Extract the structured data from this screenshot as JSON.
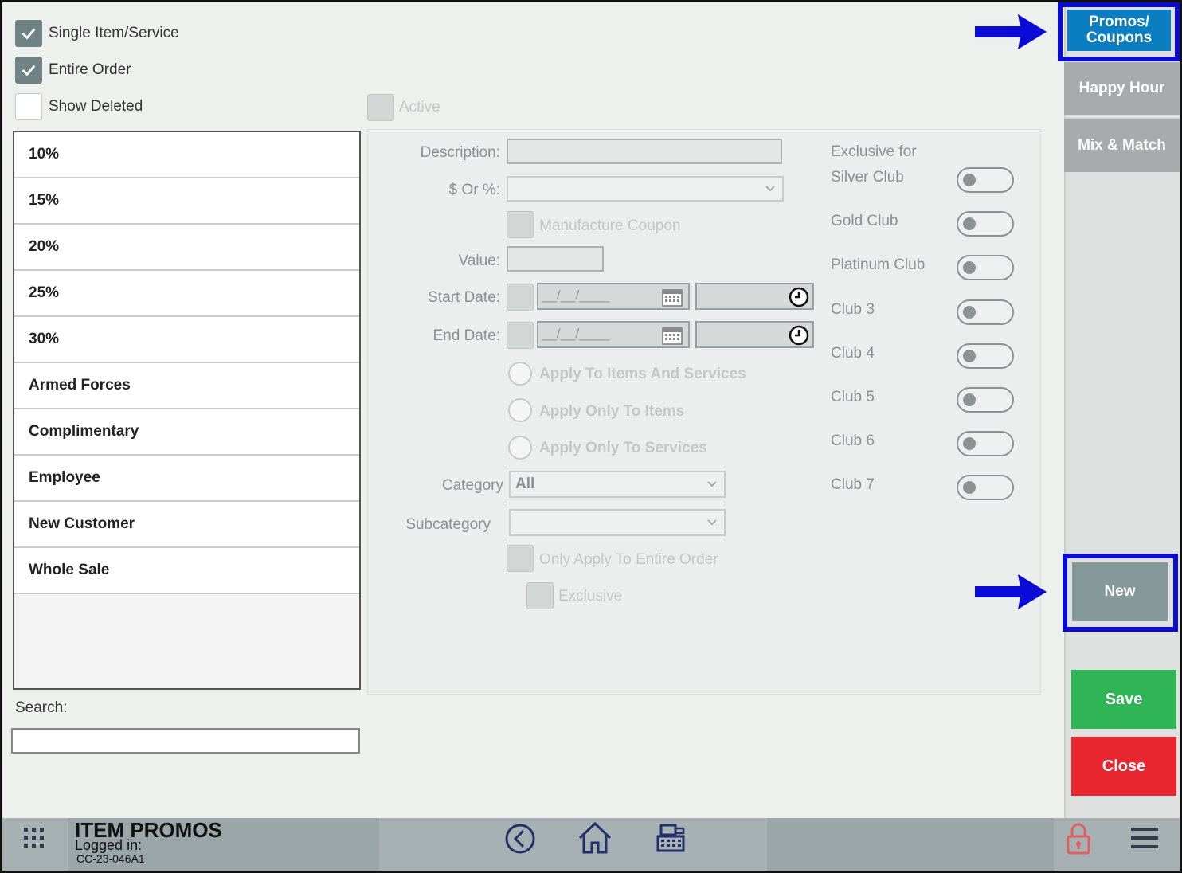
{
  "filters": {
    "single_item_service": {
      "label": "Single Item/Service",
      "checked": true
    },
    "entire_order": {
      "label": "Entire Order",
      "checked": true
    },
    "show_deleted": {
      "label": "Show Deleted",
      "checked": false
    }
  },
  "promo_list": [
    "10%",
    "15%",
    "20%",
    "25%",
    "30%",
    "Armed Forces",
    "Complimentary",
    "Employee",
    "New Customer",
    "Whole Sale"
  ],
  "search": {
    "label": "Search:",
    "value": ""
  },
  "detail": {
    "active_label": "Active",
    "description_label": "Description:",
    "dollar_or_percent_label": "$ Or %:",
    "manufacture_coupon_label": "Manufacture Coupon",
    "value_label": "Value:",
    "start_date_label": "Start Date:",
    "end_date_label": "End Date:",
    "date_placeholder": "__/__/____",
    "apply_items_services": "Apply To Items And Services",
    "apply_only_items": "Apply Only To Items",
    "apply_only_services": "Apply Only To Services",
    "category_label": "Category",
    "category_value": "All",
    "subcategory_label": "Subcategory",
    "only_entire_order_label": "Only Apply To Entire Order",
    "exclusive_label": "Exclusive"
  },
  "clubs": {
    "heading": "Exclusive for",
    "items": [
      "Silver Club",
      "Gold Club",
      "Platinum Club",
      "Club 3",
      "Club 4",
      "Club 5",
      "Club 6",
      "Club 7"
    ]
  },
  "right_nav": {
    "promos_coupons": "Promos/ Coupons",
    "happy_hour": "Happy Hour",
    "mix_match": "Mix & Match",
    "new": "New",
    "save": "Save",
    "close": "Close"
  },
  "bottom_bar": {
    "title": "ITEM PROMOS",
    "logged_in": "Logged in:",
    "station_id": "CC-23-046A1"
  },
  "colors": {
    "promos_active": "#0b7ec2",
    "save": "#2fb456",
    "close": "#e82630",
    "highlight": "#0b0bd6"
  }
}
